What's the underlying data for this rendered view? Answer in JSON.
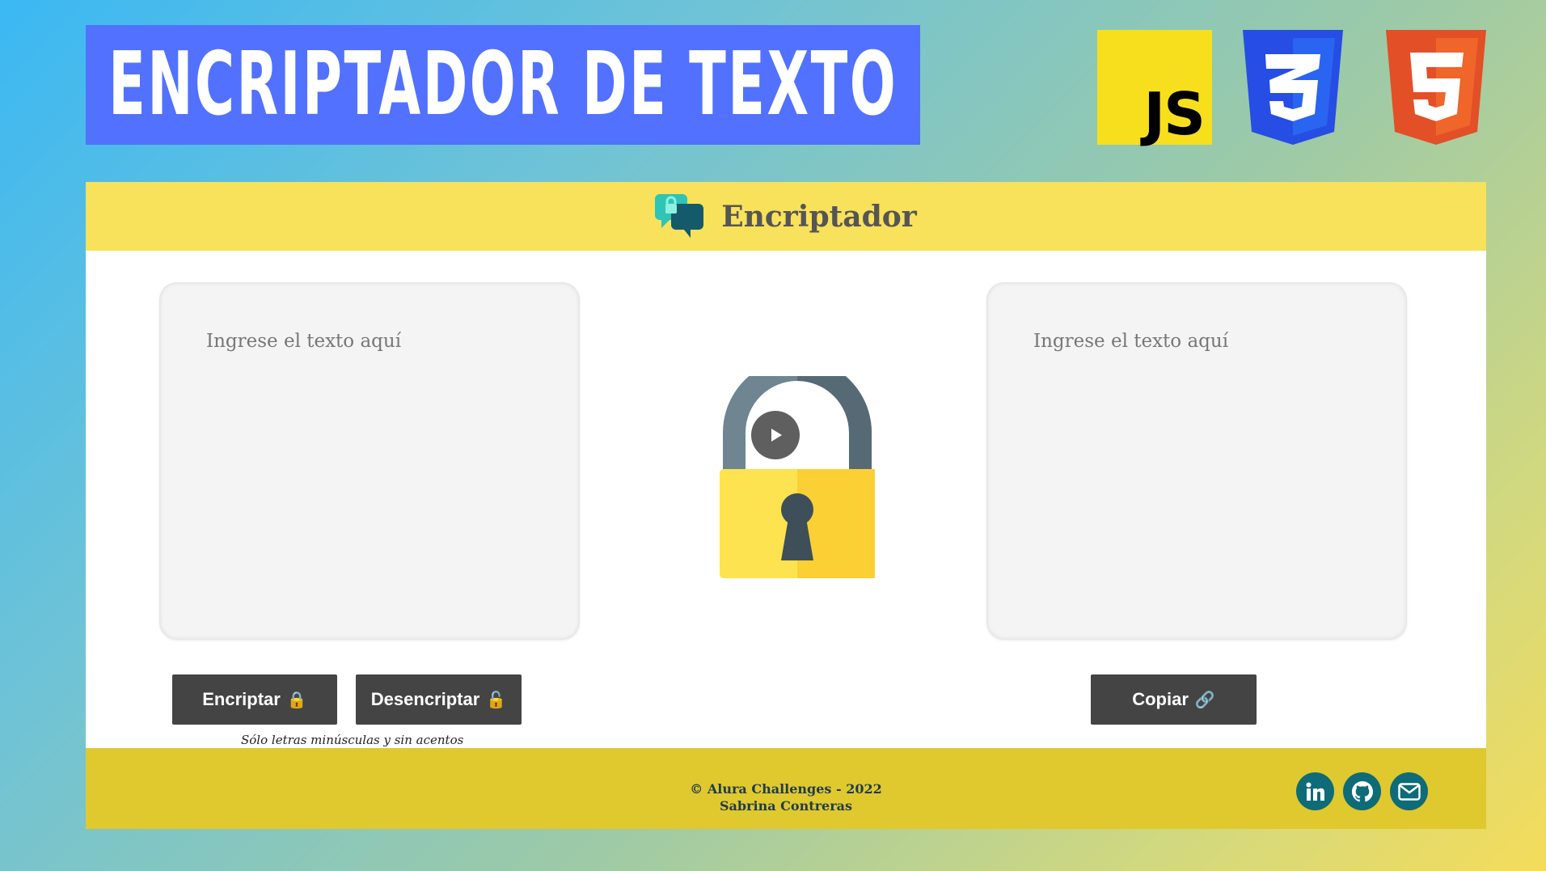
{
  "banner": {
    "title": "ENCRIPTADOR DE TEXTO"
  },
  "logos": {
    "js": "JS",
    "css": "css3-logo",
    "html": "html5-logo"
  },
  "header": {
    "title": "Encriptador",
    "icon": "chat-lock-icon"
  },
  "input": {
    "placeholder": "Ingrese el texto aquí",
    "value": ""
  },
  "output": {
    "placeholder": "Ingrese el texto aquí",
    "value": ""
  },
  "buttons": {
    "encrypt": "Encriptar",
    "decrypt": "Desencriptar",
    "copy": "Copiar"
  },
  "hint": "Sólo letras minúsculas y sin acentos",
  "footer": {
    "line1": "© Alura Challenges - 2022",
    "line2": "Sabrina Contreras",
    "social": [
      "linkedin-icon",
      "github-icon",
      "mail-icon"
    ]
  },
  "colors": {
    "banner": "#5271ff",
    "header": "#f8e15b",
    "footer": "#e0c82f",
    "button": "#444444",
    "social": "#0e6b78"
  }
}
